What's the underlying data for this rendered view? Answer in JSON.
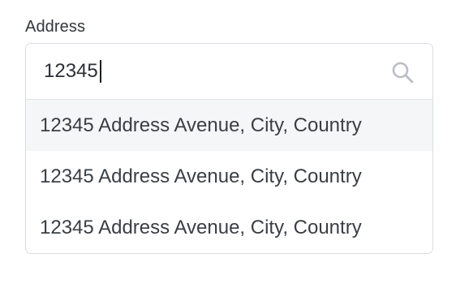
{
  "field": {
    "label": "Address",
    "input_value": "12345"
  },
  "icons": {
    "search": "search-icon"
  },
  "suggestions": [
    {
      "text": "12345 Address Avenue, City, Country",
      "highlighted": true
    },
    {
      "text": "12345 Address Avenue, City, Country",
      "highlighted": false
    },
    {
      "text": "12345 Address Avenue, City, Country",
      "highlighted": false
    }
  ],
  "colors": {
    "border": "#d9dde2",
    "highlight": "#f5f6f7",
    "text": "#2b2f36",
    "icon": "#b9bec5"
  }
}
